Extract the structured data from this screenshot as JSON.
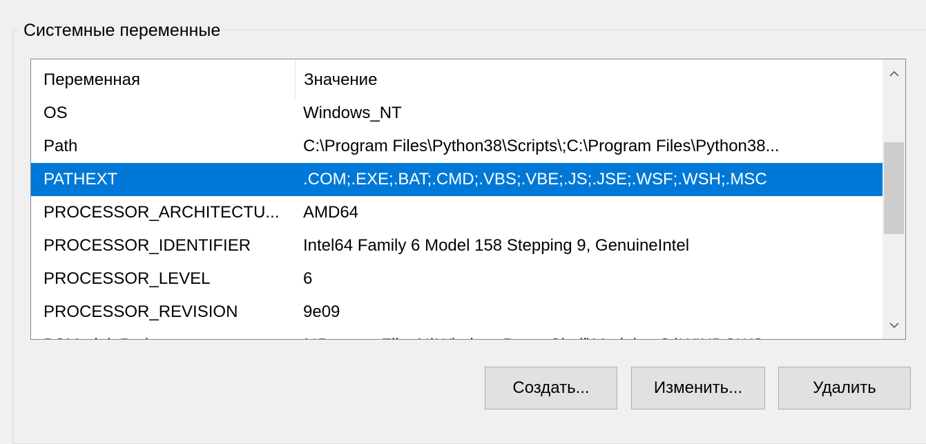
{
  "group": {
    "title": "Системные переменные"
  },
  "table": {
    "columns": [
      "Переменная",
      "Значение"
    ],
    "rows": [
      {
        "name": "OS",
        "value": "Windows_NT",
        "selected": false
      },
      {
        "name": "Path",
        "value": "C:\\Program Files\\Python38\\Scripts\\;C:\\Program Files\\Python38...",
        "selected": false
      },
      {
        "name": "PATHEXT",
        "value": ".COM;.EXE;.BAT;.CMD;.VBS;.VBE;.JS;.JSE;.WSF;.WSH;.MSC",
        "selected": true
      },
      {
        "name": "PROCESSOR_ARCHITECTU...",
        "value": "AMD64",
        "selected": false
      },
      {
        "name": "PROCESSOR_IDENTIFIER",
        "value": "Intel64 Family 6 Model 158 Stepping 9, GenuineIntel",
        "selected": false
      },
      {
        "name": "PROCESSOR_LEVEL",
        "value": "6",
        "selected": false
      },
      {
        "name": "PROCESSOR_REVISION",
        "value": "9e09",
        "selected": false
      },
      {
        "name": "PSModulePath",
        "value": "%ProgramFiles%\\WindowsPowerShell\\Modules;C:\\WINDOWS...",
        "selected": false
      }
    ]
  },
  "scrollbar": {
    "up_icon": "chevron-up-icon",
    "down_icon": "chevron-down-icon"
  },
  "buttons": {
    "create_label": "Создать...",
    "edit_label": "Изменить...",
    "delete_label": "Удалить"
  },
  "colors": {
    "selection": "#0078d7",
    "selection_text": "#ffffff",
    "button_face": "#e1e1e1",
    "window_bg": "#f0f0f0"
  }
}
